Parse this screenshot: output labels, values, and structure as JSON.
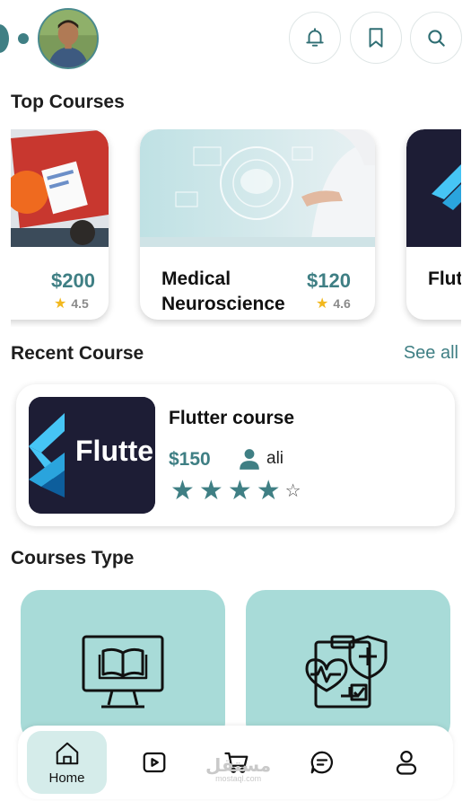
{
  "header": {
    "profile_alt": "user-avatar",
    "icons": [
      "bell-icon",
      "bookmark-icon",
      "search-icon"
    ]
  },
  "sections": {
    "top_courses": "Top Courses",
    "recent_course": "Recent Course",
    "see_all": "See all",
    "courses_type": "Courses Type"
  },
  "top_courses": [
    {
      "name": "",
      "price": "$200",
      "rating": "4.5"
    },
    {
      "name": "Medical Neuroscience",
      "price": "$120",
      "rating": "4.6"
    },
    {
      "name": "Flut",
      "price": "",
      "rating": ""
    }
  ],
  "recent_course": {
    "thumbnail_text": "Flutte",
    "title": "Flutter course",
    "price": "$150",
    "author": "ali",
    "stars_filled": 4,
    "stars_total": 5
  },
  "course_types": [
    {
      "icon": "computer-book-icon"
    },
    {
      "icon": "medical-clipboard-icon"
    }
  ],
  "bottom_nav": {
    "home_label": "Home",
    "items": [
      "home-icon",
      "video-icon",
      "cart-icon",
      "chat-icon",
      "profile-icon"
    ]
  },
  "watermark": {
    "arabic": "مستقل",
    "latin": "mostaql.com"
  },
  "colors": {
    "accent": "#3f7f84",
    "card_teal": "#a8dbd8",
    "star": "#f2b81e"
  }
}
